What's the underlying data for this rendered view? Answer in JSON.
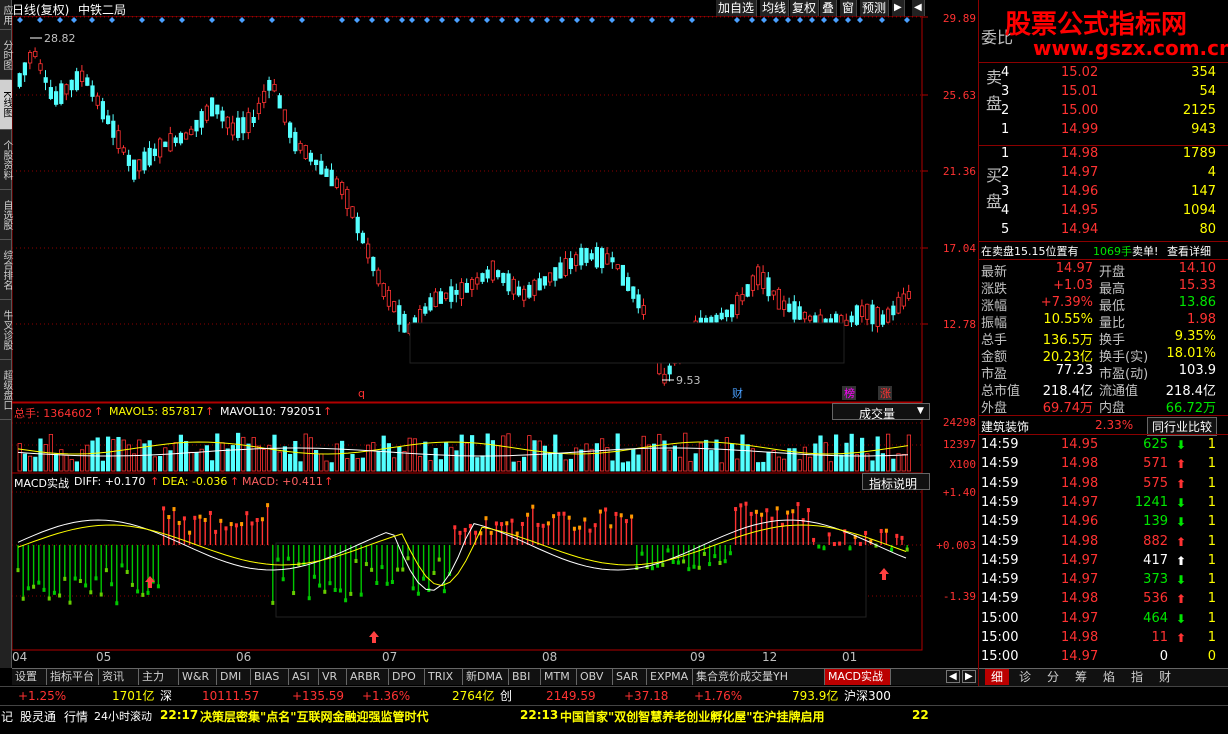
{
  "left_tabs": [
    "应用",
    "分时图",
    "K线图",
    "个股资料",
    "自选股",
    "综合排名",
    "牛叉诊股",
    "超级盘口"
  ],
  "left_active": 2,
  "chart_title": "日线(复权)",
  "stock_name": "中铁二局",
  "toolbar": [
    "加自选",
    "均线",
    "复权",
    "叠",
    "窗",
    "预测"
  ],
  "toolbar_arrow": "◀",
  "toolbar_arrow2": "▶",
  "price_axis": [
    "29.89",
    "25.63",
    "21.36",
    "17.04",
    "12.78"
  ],
  "high_mark": "28.82",
  "low_mark": "9.53",
  "event_marks": [
    {
      "text": "q",
      "color": "#ff3232"
    },
    {
      "text": "财",
      "color": "#4aa0ff"
    },
    {
      "text": "榜",
      "color": "#ff00ff"
    },
    {
      "text": "涨",
      "color": "#ff3232"
    }
  ],
  "volume_header": {
    "label1": "总手: 1364602",
    "label2": "MAVOL5: 857817",
    "label3": "MAVOL10: 792051",
    "arrow": "↑",
    "dropdown": "成交量",
    "dropdown_arrow": "▼"
  },
  "volume_axis": [
    "24298",
    "12397",
    "X100"
  ],
  "macd_header": {
    "label0": "MACD实战",
    "diff": "DIFF: +0.170",
    "dea": "DEA: -0.036",
    "macd": "MACD: +0.411",
    "arrow": "↑",
    "help": "指标说明"
  },
  "macd_axis": [
    "+1.40",
    "+0.003",
    "-1.39"
  ],
  "date_axis": [
    "04",
    "05",
    "06",
    "07",
    "08",
    "09",
    "12",
    "01"
  ],
  "bottom_tabs": [
    "设置",
    "指标平台",
    "资讯",
    "主力",
    "W&R",
    "DMI",
    "BIAS",
    "ASI",
    "VR",
    "ARBR",
    "DPO",
    "TRIX",
    "新DMA",
    "BBI",
    "MTM",
    "OBV",
    "SAR",
    "EXPMA",
    "集合竞价成交量YH",
    "MACD实战"
  ],
  "bottom_active": 19,
  "right_panel": {
    "watermark_title": "股票公式指标网",
    "watermark_url": "www.gszx.com.cn",
    "committee_label": "委比",
    "sell_label": "卖盘",
    "buy_label": "买盘",
    "asks": [
      {
        "lvl": "4",
        "price": "15.02",
        "vol": "354"
      },
      {
        "lvl": "3",
        "price": "15.01",
        "vol": "54"
      },
      {
        "lvl": "2",
        "price": "15.00",
        "vol": "2125"
      },
      {
        "lvl": "1",
        "price": "14.99",
        "vol": "943"
      }
    ],
    "bids": [
      {
        "lvl": "1",
        "price": "14.98",
        "vol": "1789"
      },
      {
        "lvl": "2",
        "price": "14.97",
        "vol": "4"
      },
      {
        "lvl": "3",
        "price": "14.96",
        "vol": "147"
      },
      {
        "lvl": "4",
        "price": "14.95",
        "vol": "1094"
      },
      {
        "lvl": "5",
        "price": "14.94",
        "vol": "80"
      }
    ],
    "notice": {
      "p1": "在卖盘15.15位置有",
      "p2": "1069手",
      "p3": "卖单!",
      "p4": "查看详细"
    },
    "stats": [
      {
        "k1": "最新",
        "v1": "14.97",
        "c1": "#ff3232",
        "k2": "开盘",
        "v2": "14.10",
        "c2": "#ff3232"
      },
      {
        "k1": "涨跌",
        "v1": "+1.03",
        "c1": "#ff3232",
        "k2": "最高",
        "v2": "15.33",
        "c2": "#ff3232"
      },
      {
        "k1": "涨幅",
        "v1": "+7.39%",
        "c1": "#ff3232",
        "k2": "最低",
        "v2": "13.86",
        "c2": "#00e600"
      },
      {
        "k1": "振幅",
        "v1": "10.55%",
        "c1": "#ffff00",
        "k2": "量比",
        "v2": "1.98",
        "c2": "#ff3232"
      },
      {
        "k1": "总手",
        "v1": "136.5万",
        "c1": "#ffff00",
        "k2": "换手",
        "v2": "9.35%",
        "c2": "#ffff00"
      },
      {
        "k1": "金额",
        "v1": "20.23亿",
        "c1": "#ffff00",
        "k2": "换手(实)",
        "v2": "18.01%",
        "c2": "#ffff00"
      },
      {
        "k1": "市盈",
        "v1": "77.23",
        "c1": "#ffffff",
        "k2": "市盈(动)",
        "v2": "103.9",
        "c2": "#ffffff"
      },
      {
        "k1": "总市值",
        "v1": "218.4亿",
        "c1": "#ffffff",
        "k2": "流通值",
        "v2": "218.4亿",
        "c2": "#ffffff"
      },
      {
        "k1": "外盘",
        "v1": "69.74万",
        "c1": "#ff3232",
        "k2": "内盘",
        "v2": "66.72万",
        "c2": "#00e600"
      }
    ],
    "sector": {
      "name": "建筑装饰",
      "pct": "2.33%",
      "btn": "同行业比较"
    },
    "ticks": [
      {
        "t": "14:59",
        "p": "14.95",
        "v": "625",
        "d": "down",
        "n": "1"
      },
      {
        "t": "14:59",
        "p": "14.98",
        "v": "571",
        "d": "up",
        "n": "1"
      },
      {
        "t": "14:59",
        "p": "14.98",
        "v": "575",
        "d": "up",
        "n": "1"
      },
      {
        "t": "14:59",
        "p": "14.97",
        "v": "1241",
        "d": "down",
        "n": "1"
      },
      {
        "t": "14:59",
        "p": "14.96",
        "v": "139",
        "d": "down",
        "n": "1"
      },
      {
        "t": "14:59",
        "p": "14.98",
        "v": "882",
        "d": "up",
        "n": "1"
      },
      {
        "t": "14:59",
        "p": "14.97",
        "v": "417",
        "d": "white",
        "n": "1"
      },
      {
        "t": "14:59",
        "p": "14.97",
        "v": "373",
        "d": "down",
        "n": "1"
      },
      {
        "t": "14:59",
        "p": "14.98",
        "v": "536",
        "d": "up",
        "n": "1"
      },
      {
        "t": "15:00",
        "p": "14.97",
        "v": "464",
        "d": "down",
        "n": "1"
      },
      {
        "t": "15:00",
        "p": "14.98",
        "v": "11",
        "d": "up",
        "n": "1"
      },
      {
        "t": "15:00",
        "p": "14.97",
        "v": "0",
        "d": "none",
        "n": "0"
      }
    ],
    "tabs": [
      "细",
      "诊",
      "分",
      "筹",
      "焰",
      "指",
      "财"
    ]
  },
  "status1": {
    "a": "+1.25%",
    "b": "1701亿",
    "c": "深",
    "d": "10111.57",
    "e": "+135.59",
    "f": "+1.36%",
    "g": "2764亿",
    "h": "创",
    "i": "2149.59",
    "j": "+37.18",
    "k": "+1.76%",
    "l": "793.9亿",
    "m": "沪深300"
  },
  "status2": {
    "items": [
      "记",
      "股灵通",
      "行情",
      "24小时滚动"
    ],
    "news1_time": "22:17",
    "news1": "决策层密集\"点名\"互联网金融迎强监管时代",
    "news2_time": "22:13",
    "news2": "中国首家\"双创智慧养老创业孵化屋\"在沪挂牌启用",
    "news3": "22"
  },
  "colors": {
    "up": "#ff3232",
    "down": "#54ffff",
    "grid": "#8b0000",
    "axis": "#b00000"
  }
}
